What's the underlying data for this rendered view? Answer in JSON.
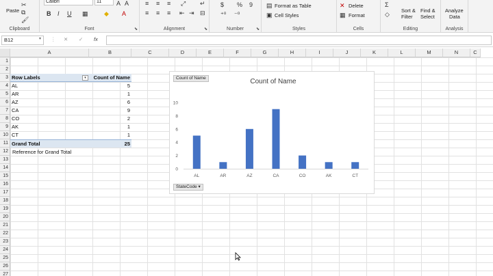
{
  "ribbon": {
    "clipboard": {
      "paste_label": "Paste",
      "group_label": "Clipboard"
    },
    "font": {
      "font_name": "Calibri",
      "font_size": "11",
      "group_label": "Font",
      "bold": "B",
      "italic": "I",
      "underline": "U"
    },
    "alignment": {
      "group_label": "Alignment"
    },
    "number": {
      "group_label": "Number",
      "percent": "%",
      "comma": "9"
    },
    "styles": {
      "format_as_table": "Format as Table",
      "cell_styles": "Cell Styles",
      "group_label": "Styles"
    },
    "cells": {
      "delete": "Delete",
      "format": "Format",
      "group_label": "Cells"
    },
    "editing": {
      "sort_filter_1": "Sort &",
      "sort_filter_2": "Filter",
      "find_select_1": "Find &",
      "find_select_2": "Select",
      "group_label": "Editing"
    },
    "analysis": {
      "analyze_1": "Analyze",
      "analyze_2": "Data",
      "group_label": "Analysis"
    }
  },
  "formula_bar": {
    "name_box": "B12",
    "fx": "fx",
    "cancel": "✕",
    "enter": "✓",
    "formula": ""
  },
  "columns": [
    "A",
    "B",
    "C",
    "D",
    "E",
    "F",
    "G",
    "H",
    "I",
    "J",
    "K",
    "L",
    "M",
    "N",
    "C"
  ],
  "rows": [
    "1",
    "2",
    "3",
    "4",
    "5",
    "6",
    "7",
    "8",
    "9",
    "10",
    "11",
    "12",
    "13",
    "14",
    "15",
    "16",
    "17",
    "18",
    "19",
    "20",
    "21",
    "22",
    "23",
    "24",
    "25",
    "26",
    "27"
  ],
  "pivot": {
    "header_label": "Row Labels",
    "header_value": "Count of Name",
    "items": [
      {
        "label": "AL",
        "value": "5"
      },
      {
        "label": "AR",
        "value": "1"
      },
      {
        "label": "AZ",
        "value": "6"
      },
      {
        "label": "CA",
        "value": "9"
      },
      {
        "label": "CO",
        "value": "2"
      },
      {
        "label": "AK",
        "value": "1"
      },
      {
        "label": "CT",
        "value": "1"
      }
    ],
    "total_label": "Grand Total",
    "total_value": "25",
    "note": "Reference for Grand Total"
  },
  "chart_data": {
    "type": "bar",
    "title": "Count of Name",
    "value_button": "Count of Name",
    "field_button": "StateCode",
    "categories": [
      "AL",
      "AR",
      "AZ",
      "CA",
      "CO",
      "AK",
      "CT"
    ],
    "values": [
      5,
      1,
      6,
      9,
      2,
      1,
      1
    ],
    "ylim": [
      0,
      10
    ],
    "yticks": [
      0,
      2,
      4,
      6,
      8,
      10
    ],
    "grid": false,
    "bar_color": "#4472c4"
  },
  "colors": {
    "pivot_header": "#dce6f1",
    "accent": "#217346"
  }
}
